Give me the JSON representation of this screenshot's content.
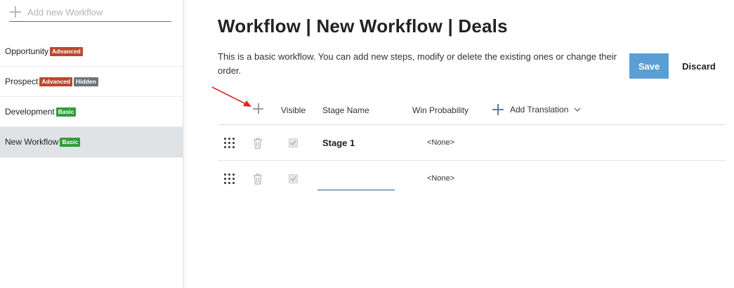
{
  "sidebar": {
    "add_label": "Add new Workflow",
    "items": [
      {
        "label": "Opportunity",
        "badges": [
          {
            "text": "Advanced",
            "kind": "advanced"
          }
        ]
      },
      {
        "label": "Prospect",
        "badges": [
          {
            "text": "Advanced",
            "kind": "advanced"
          },
          {
            "text": "Hidden",
            "kind": "hidden"
          }
        ]
      },
      {
        "label": "Development",
        "badges": [
          {
            "text": "Basic",
            "kind": "basic"
          }
        ]
      },
      {
        "label": "New Workflow",
        "badges": [
          {
            "text": "Basic",
            "kind": "basic"
          }
        ],
        "active": true
      }
    ]
  },
  "main": {
    "title": "Workflow | New Workflow | Deals",
    "description": "This is a basic workflow. You can add new steps, modify or delete the existing ones or change their order.",
    "save_label": "Save",
    "discard_label": "Discard"
  },
  "table": {
    "headers": {
      "visible": "Visible",
      "stage_name": "Stage Name",
      "win_probability": "Win Probability",
      "add_translation": "Add Translation"
    },
    "rows": [
      {
        "stage_name": "Stage 1",
        "visible": true,
        "win_probability": "<None>"
      },
      {
        "stage_name": "",
        "visible": true,
        "win_probability": "<None>"
      }
    ]
  },
  "colors": {
    "save_button": "#5a9fd4",
    "badge_advanced": "#b84a2b",
    "badge_hidden": "#6c757d",
    "badge_basic": "#2e9e3b",
    "annotation_arrow": "#e02424"
  },
  "icons": {
    "add_workflow": "plus-icon",
    "add_step": "plus-icon",
    "drag": "drag-handle-icon",
    "delete": "trash-icon",
    "add_translation": "plus-icon",
    "dropdown": "chevron-down-icon"
  }
}
